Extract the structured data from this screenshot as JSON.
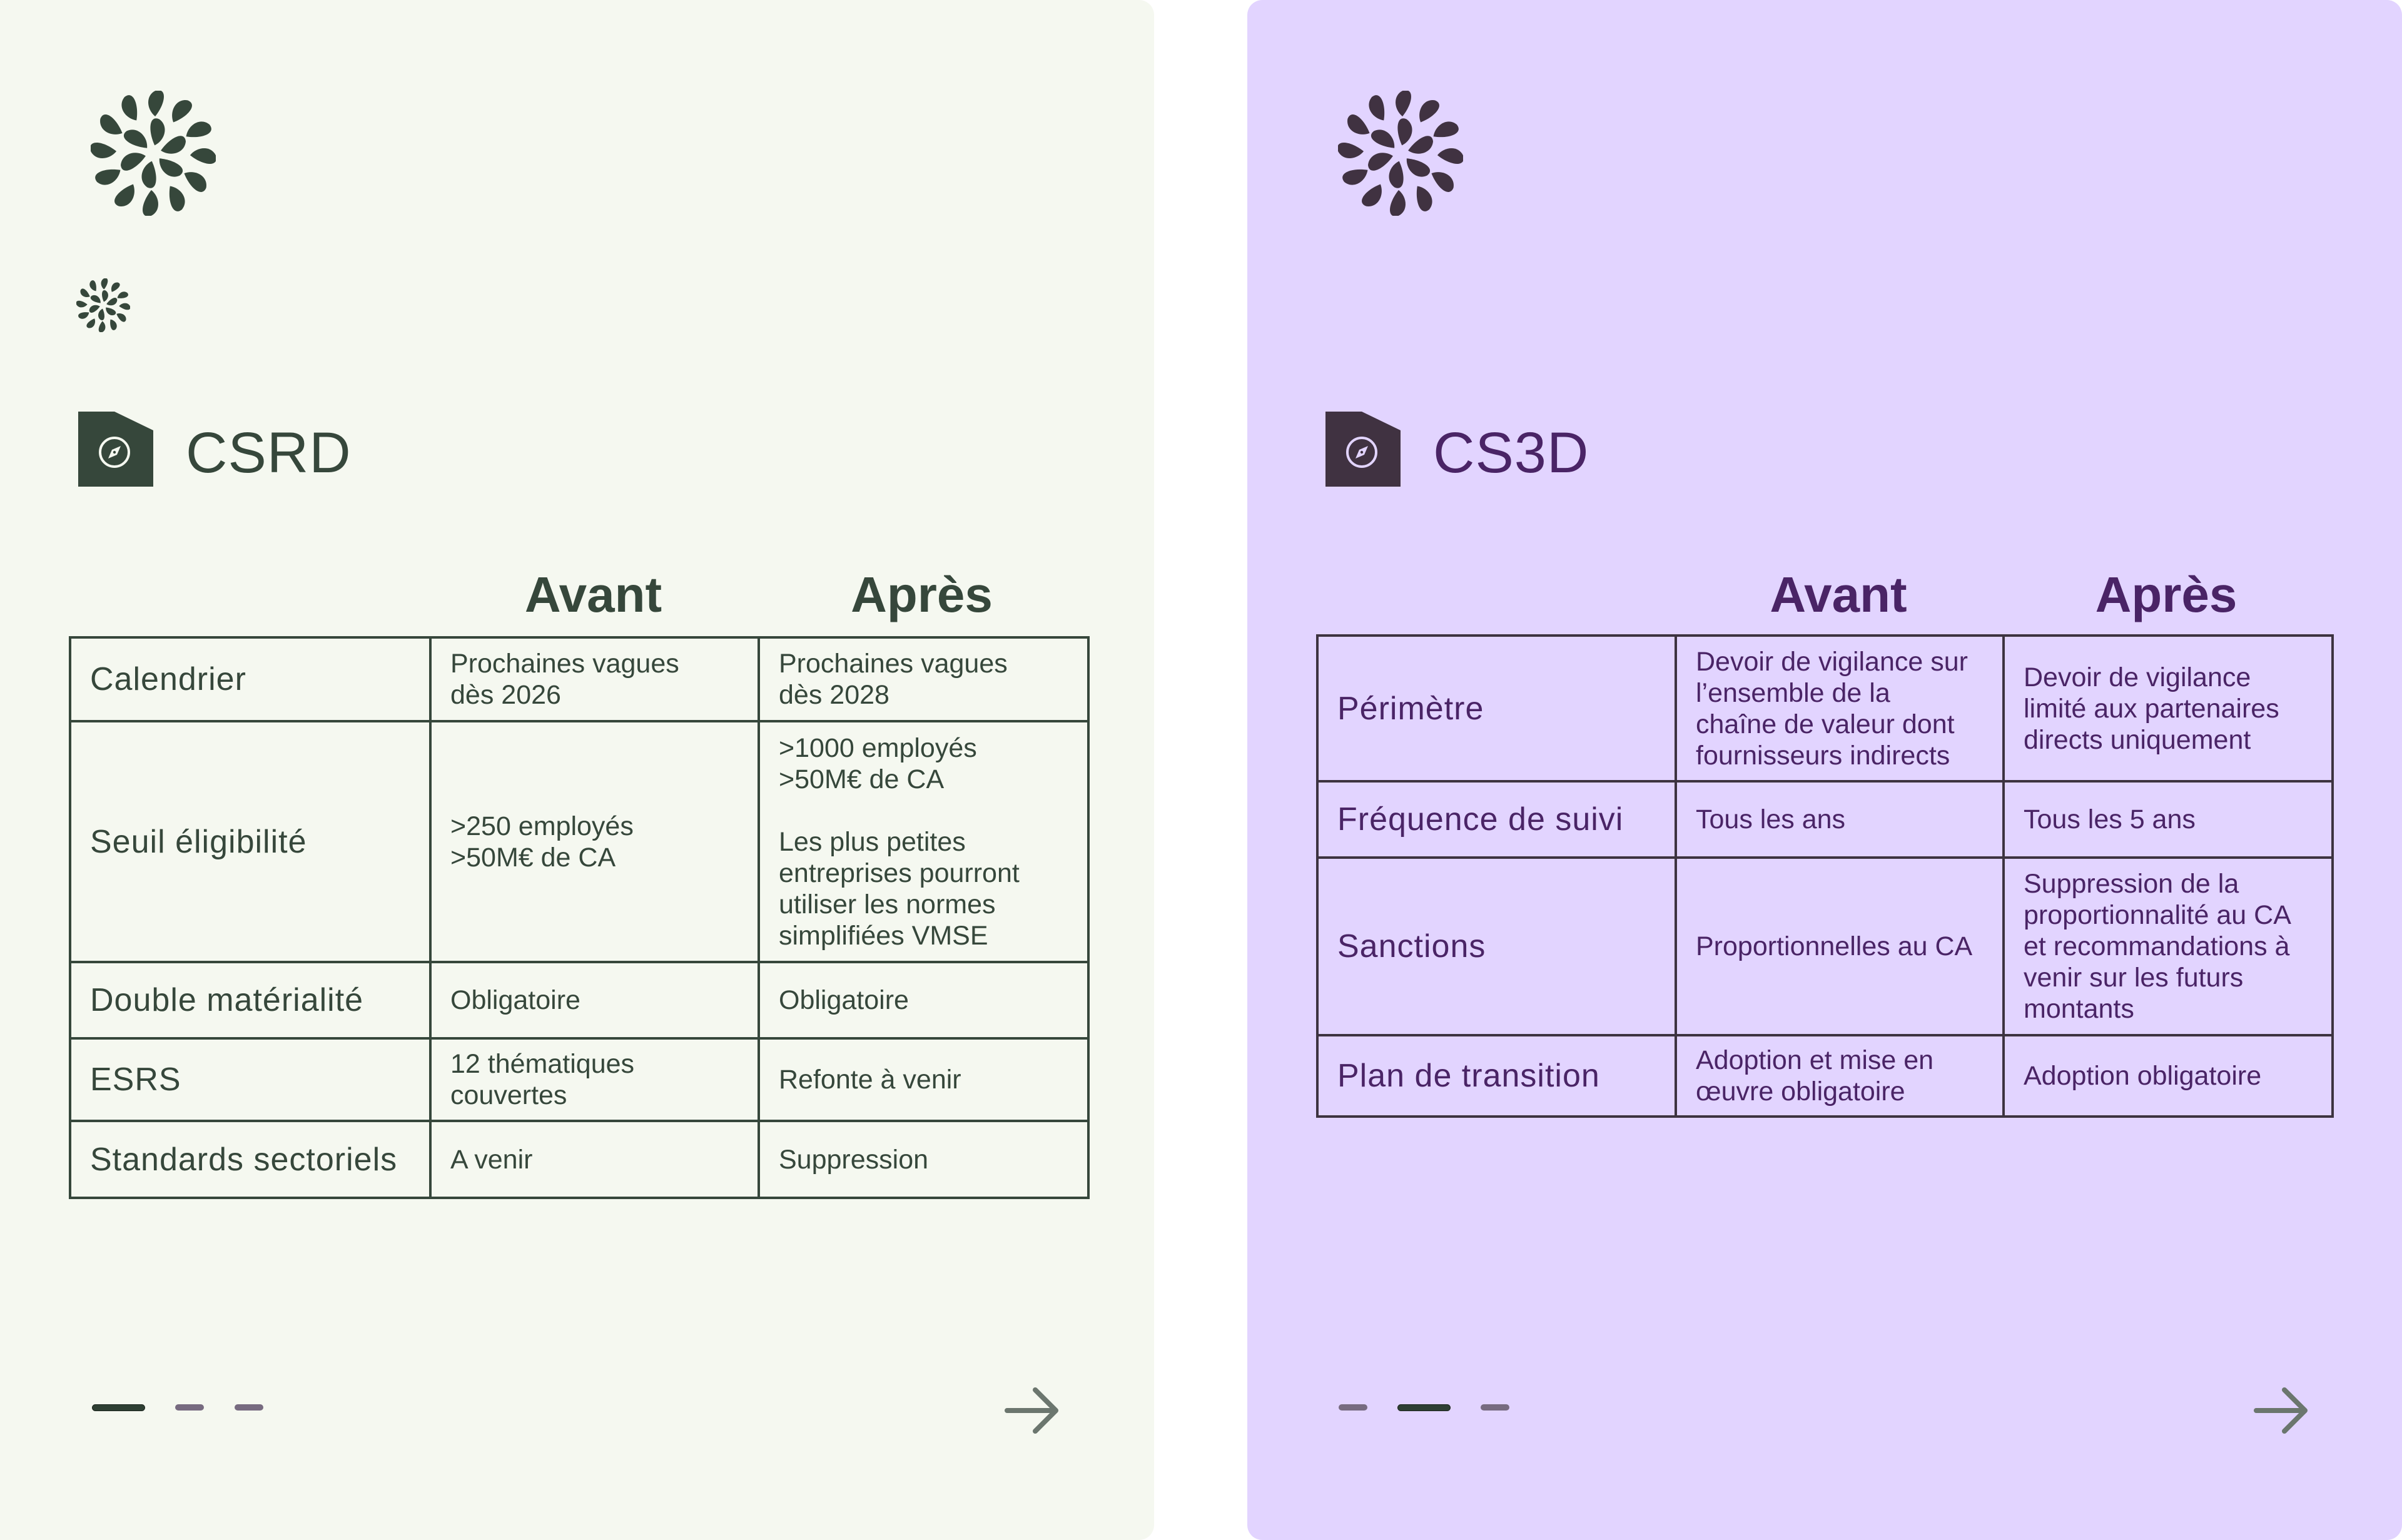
{
  "colors": {
    "csrd_bg": "#f5f8f0",
    "csrd_text": "#36473b",
    "cs3d_bg": "#e2d4ff",
    "cs3d_text": "#4a2466",
    "cs3d_icon": "#403241",
    "pager_active": "#2e3f33",
    "pager_inactive": "#776b80",
    "arrow": "#6b766e"
  },
  "cards": [
    {
      "title": "CSRD",
      "icon": "compass-icon",
      "logo": "flower-logo-icon",
      "columns": [
        "Avant",
        "Après"
      ],
      "rows": [
        {
          "label": "Calendrier",
          "avant": "Prochaines vagues\ndès 2026",
          "apres": "Prochaines vagues\ndès 2028"
        },
        {
          "label": "Seuil éligibilité",
          "avant": ">250 employés\n>50M€ de CA",
          "apres": ">1000 employés\n>50M€ de CA\n\nLes plus petites\nentreprises pourront\nutiliser les normes\nsimplifiées VMSE"
        },
        {
          "label": "Double matérialité",
          "avant": "Obligatoire",
          "apres": "Obligatoire"
        },
        {
          "label": "ESRS",
          "avant": "12 thématiques\ncouvertes",
          "apres": "Refonte à venir"
        },
        {
          "label": "Standards sectoriels",
          "avant": "A venir",
          "apres": "Suppression"
        }
      ],
      "pager": {
        "total": 3,
        "active": 1
      },
      "next_label": "next-arrow"
    },
    {
      "title": "CS3D",
      "icon": "compass-icon",
      "logo": "flower-logo-icon",
      "columns": [
        "Avant",
        "Après"
      ],
      "rows": [
        {
          "label": "Périmètre",
          "avant": "Devoir de vigilance sur\nl’ensemble de la\nchaîne de valeur dont\nfournisseurs indirects",
          "apres": "Devoir de vigilance\nlimité aux partenaires\ndirects uniquement"
        },
        {
          "label": "Fréquence de suivi",
          "avant": "Tous les ans",
          "apres": "Tous les 5 ans"
        },
        {
          "label": "Sanctions",
          "avant": "Proportionnelles au CA",
          "apres": "Suppression de la\nproportionnalité au CA\net recommandations à\nvenir sur les futurs\nmontants"
        },
        {
          "label": "Plan de transition",
          "avant": "Adoption et mise en\nœuvre obligatoire",
          "apres": "Adoption obligatoire"
        }
      ],
      "pager": {
        "total": 3,
        "active": 2
      },
      "next_label": "next-arrow"
    }
  ]
}
